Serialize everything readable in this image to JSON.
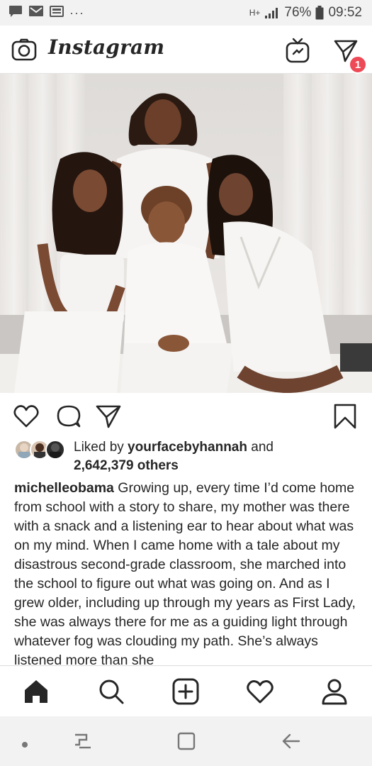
{
  "status_bar": {
    "battery": "76%",
    "time": "09:52",
    "network": "H+",
    "icons": [
      "chat-icon",
      "gmail-icon",
      "news-icon",
      "more-icon"
    ]
  },
  "app": {
    "logo": "Instagram",
    "dm_badge": "1"
  },
  "post": {
    "image_alt": "Family photo of four women dressed in white",
    "liked_by_prefix": "Liked by ",
    "liked_by_user": "yourfacebyhannah",
    "liked_by_and": " and",
    "likes_others": "2,642,379 others",
    "caption_user": "michelleobama",
    "caption_text": " Growing up, every time I’d come home from school with a story to share, my mother was there with a snack and a listening ear to hear about what was on my mind. When I came home with a tale about my disastrous second-grade classroom, she marched into the school to figure out what was going on. And as I grew older, including up through my years as First Lady, she was always there for me as a guiding light through whatever fog was clouding my path. She’s always listened more than she"
  },
  "colors": {
    "accent": "#ed4956",
    "text": "#262626"
  }
}
